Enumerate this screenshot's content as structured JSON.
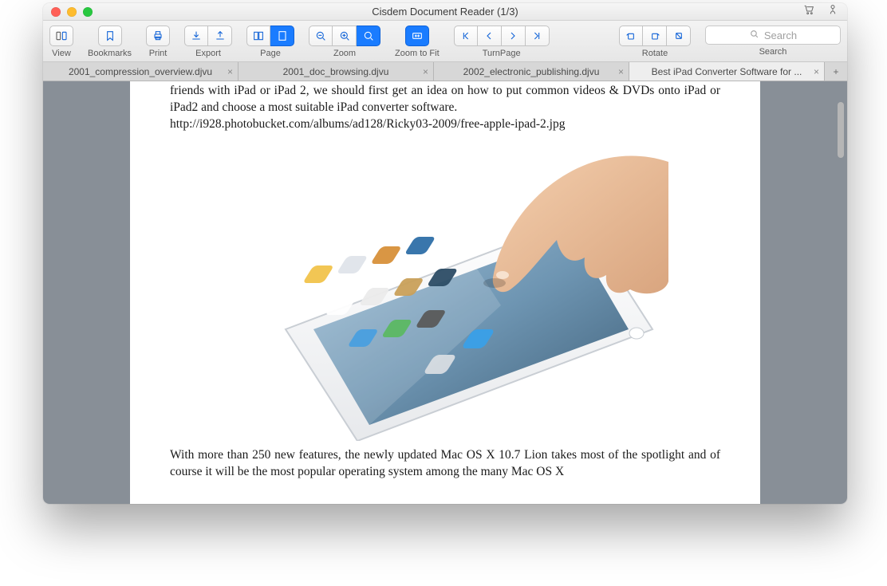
{
  "window": {
    "title": "Cisdem Document Reader (1/3)"
  },
  "toolbar": {
    "groups": {
      "view": "View",
      "bookmarks": "Bookmarks",
      "print": "Print",
      "export": "Export",
      "page": "Page",
      "zoom": "Zoom",
      "zoomToFit": "Zoom to Fit",
      "turnPage": "TurnPage",
      "rotate": "Rotate",
      "search": "Search"
    },
    "searchPlaceholder": "Search"
  },
  "tabs": [
    {
      "label": "2001_compression_overview.djvu",
      "active": false
    },
    {
      "label": "2001_doc_browsing.djvu",
      "active": false
    },
    {
      "label": "2002_electronic_publishing.djvu",
      "active": false
    },
    {
      "label": "Best iPad Converter Software for ...",
      "active": true
    }
  ],
  "document": {
    "para1": "friends with iPad or iPad 2, we should first get an idea on how to put common videos & DVDs onto iPad or iPad2 and choose a most suitable iPad converter software.",
    "imgUrlText": "http://i928.photobucket.com/albums/ad128/Ricky03-2009/free-apple-ipad-2.jpg",
    "para2": "With more than 250 new features, the newly updated Mac OS X 10.7 Lion takes most of the spotlight and of course it will be the most popular operating system among the many Mac OS X"
  }
}
